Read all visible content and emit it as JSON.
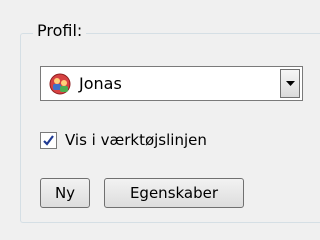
{
  "profile_group": {
    "legend": "Profil:",
    "selected_profile": "Jonas",
    "toolbar_checkbox": {
      "label": "Vis i værktøjslinjen",
      "checked": true
    },
    "new_button": "Ny",
    "properties_button": "Egenskaber"
  },
  "colors": {
    "background": "#f0f0f0",
    "group_border": "#d5dfe5",
    "checkmark": "#1f3a93"
  },
  "icons": {
    "profile_avatar": "profile-avatar-icon",
    "dropdown": "chevron-down-icon",
    "check": "checkmark-icon"
  }
}
